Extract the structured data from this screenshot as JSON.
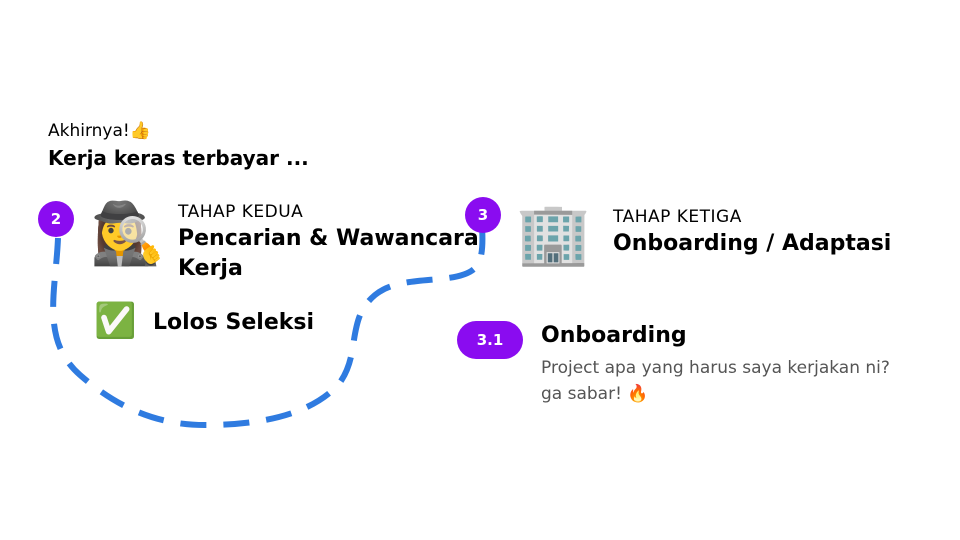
{
  "intro": {
    "small": "Akhirnya!👍",
    "big": "Kerja keras terbayar ..."
  },
  "stage2": {
    "badge": "2",
    "label": "TAHAP KEDUA",
    "title_line1": "Pencarian & Wawancara",
    "title_line2": "Kerja",
    "emoji": "🕵️‍♀️",
    "result_icon": "✅",
    "result_text": "Lolos Seleksi"
  },
  "stage3": {
    "badge": "3",
    "label": "TAHAP KETIGA",
    "title": "Onboarding / Adaptasi",
    "emoji": "🏢"
  },
  "step31": {
    "badge": "3.1",
    "title": "Onboarding",
    "line1": "Project apa yang harus saya kerjakan ni?",
    "line2": "ga sabar! 🔥"
  },
  "colors": {
    "badge": "#8a0cf0",
    "path": "#2f7be0"
  },
  "icons": [
    "detective-icon",
    "check-mark-icon",
    "office-building-icon",
    "fire-icon"
  ]
}
